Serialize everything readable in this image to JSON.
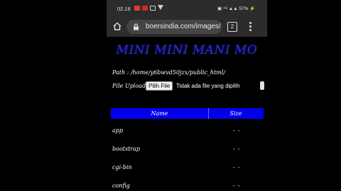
{
  "status_bar": {
    "time": "02.16",
    "right_text": "▣ ⁴ᴳ ▲▲ 57% ⚡",
    "icon_colors": [
      "#e23a3a",
      "#cc2b2b",
      "#d0d0d0",
      "#d0d0d0"
    ]
  },
  "browser": {
    "url": "boersindia.com/images/",
    "tab_count": "2",
    "home_icon": "home-icon",
    "lock_icon": "lock-icon",
    "menu_icon": "more-vert-icon"
  },
  "page": {
    "title": "MINI MINI MANI MO",
    "path_label": "Path :",
    "path_value": "/home/y6bwvd50jzx/public_html/",
    "upload_label": "File Upload :",
    "file_button_label": "Pilih File",
    "file_status": "Tidak ada file yang dipilih",
    "table": {
      "headers": [
        "Name",
        "Size"
      ],
      "rows": [
        {
          "name": "app",
          "size": "- -"
        },
        {
          "name": "bootstrap",
          "size": "- -"
        },
        {
          "name": "cgi-bin",
          "size": "- -"
        },
        {
          "name": "config",
          "size": "- -"
        }
      ]
    }
  },
  "colors": {
    "title_blue": "#2b2bd6",
    "table_header": "#0000ee",
    "chrome_bg": "#2c2c2c"
  }
}
